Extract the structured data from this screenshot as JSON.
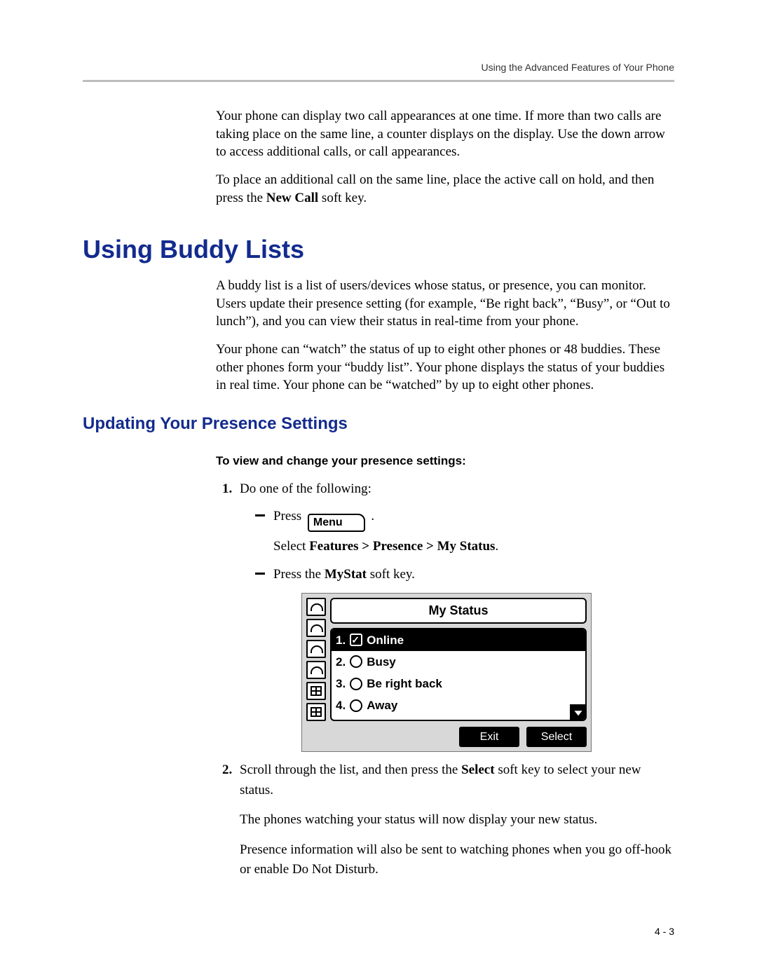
{
  "header": {
    "running_title": "Using the Advanced Features of Your Phone"
  },
  "intro": {
    "p1": "Your phone can display two call appearances at one time. If more than two calls are taking place on the same line, a counter displays on the display. Use the down arrow to access additional calls, or call appearances.",
    "p2_pre": "To place an additional call on the same line, place the active call on hold, and then press the ",
    "p2_bold": "New Call",
    "p2_post": " soft key."
  },
  "section": {
    "h1": "Using Buddy Lists",
    "p1": "A buddy list is a list of users/devices whose status, or presence, you can monitor. Users update their presence setting (for example, “Be right back”, “Busy”, or “Out to lunch”), and you can view their status in real-time from your phone.",
    "p2": "Your phone can “watch” the status of up to eight other phones or 48 buddies. These other phones form your “buddy list”. Your phone displays the status of your buddies in real time. Your phone can be “watched” by up to eight other phones."
  },
  "subsection": {
    "h2": "Updating Your Presence Settings",
    "task_title": "To view and change your presence settings:",
    "step1": {
      "lead": "Do one of the following:",
      "opt_a_pre": "Press ",
      "opt_a_btn": "Menu",
      "opt_a_post": " .",
      "opt_a_select_pre": "Select ",
      "opt_a_select_bold": "Features > Presence > My Status",
      "opt_a_select_post": ".",
      "opt_b_pre": "Press the ",
      "opt_b_bold": "MyStat",
      "opt_b_post": " soft key."
    },
    "screen": {
      "title": "My Status",
      "items": [
        {
          "num": "1.",
          "label": "Online",
          "selected": true,
          "checked": true
        },
        {
          "num": "2.",
          "label": "Busy",
          "selected": false,
          "checked": false
        },
        {
          "num": "3.",
          "label": "Be right back",
          "selected": false,
          "checked": false
        },
        {
          "num": "4.",
          "label": "Away",
          "selected": false,
          "checked": false
        }
      ],
      "softkeys": {
        "left": "Exit",
        "right": "Select"
      }
    },
    "step2": {
      "p1_pre": "Scroll through the list, and then press the ",
      "p1_bold": "Select",
      "p1_post": " soft key to select your new status.",
      "p2": "The phones watching your status will now display your new status.",
      "p3": "Presence information will also be sent to watching phones when you go off-hook or enable Do Not Disturb."
    }
  },
  "page_number": "4 - 3"
}
